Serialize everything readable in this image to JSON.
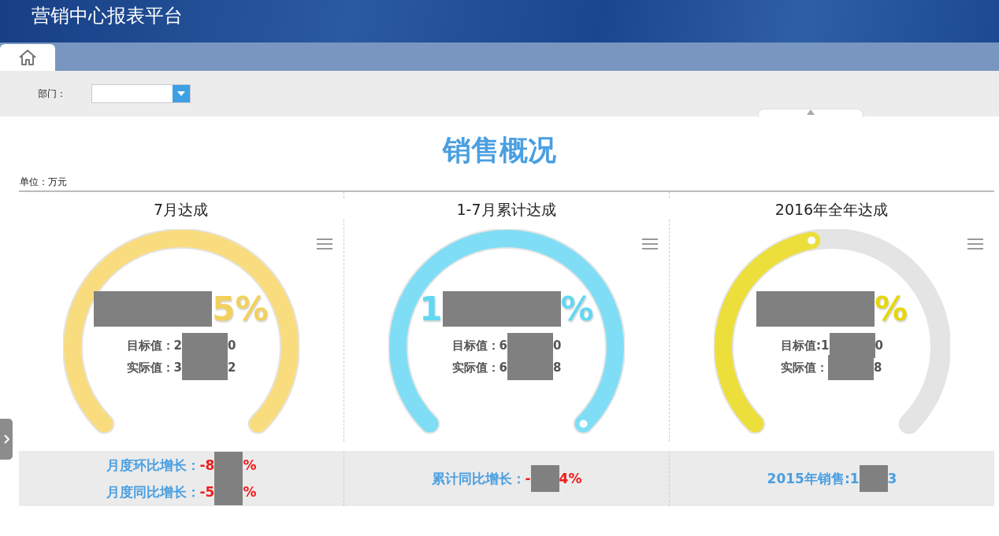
{
  "header": {
    "title": "营销中心报表平台"
  },
  "tabs": [
    {
      "kind": "home",
      "selected": true
    }
  ],
  "filter": {
    "label": "部门："
  },
  "report": {
    "title": "销售概况",
    "unit": "单位：万元"
  },
  "gauges": [
    {
      "title": "7月达成",
      "level": 1,
      "marker": false,
      "color": "#f9dc7e",
      "percent": {
        "after": "5%"
      },
      "target": {
        "before": "目标值：2",
        "after": "0"
      },
      "actual": {
        "before": "实际值：3",
        "after": "2"
      }
    },
    {
      "title": "1-7月累计达成",
      "level": 1,
      "marker": true,
      "color": "#7fdef5",
      "percent": {
        "before": "1",
        "after": "%"
      },
      "target": {
        "before": "目标值：6",
        "after": "0"
      },
      "actual": {
        "before": "实际值：6",
        "after": "8"
      }
    },
    {
      "title": "2016年全年达成",
      "level": 0.46,
      "marker": true,
      "color": "#ecdf3c",
      "percent": {
        "after": "%"
      },
      "target": {
        "before": "目标值:1",
        "after": "0"
      },
      "actual": {
        "before": "实际值：",
        "after": "8"
      }
    }
  ],
  "summary": [
    {
      "lines": [
        {
          "label": "月度环比增长：",
          "before": "-8",
          "after": "%"
        },
        {
          "label": "月度同比增长：",
          "before": "-5",
          "after": "%"
        }
      ]
    },
    {
      "lines": [
        {
          "label": "累计同比增长：",
          "before": "-",
          "after": "4%"
        }
      ]
    },
    {
      "lines": [
        {
          "label": "2015年销售:",
          "before": "1",
          "after": "3",
          "plain": true
        }
      ]
    }
  ]
}
